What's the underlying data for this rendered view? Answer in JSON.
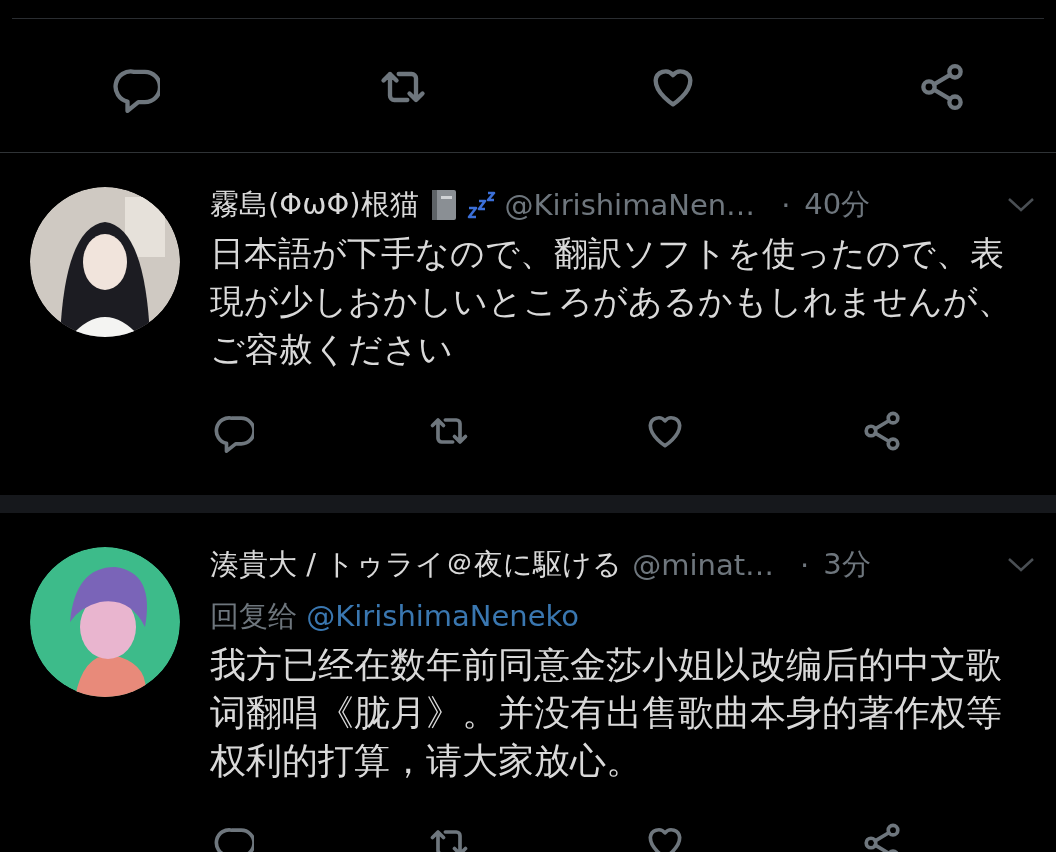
{
  "tweets": [
    {
      "name": "霧島(ΦωΦ)根猫",
      "badges": [
        {
          "kind": "book"
        },
        {
          "kind": "sleep"
        }
      ],
      "handle": "@KirishimaNen…",
      "separator": "·",
      "time": "40分",
      "text": "日本語が下手なので、翻訳ソフトを使ったので、表現が少しおかしいところがあるかもしれませんが、ご容赦ください"
    },
    {
      "name": "湊貴大 / トゥライ＠夜に駆ける",
      "handle": "@minat…",
      "separator": "·",
      "time": "3分",
      "reply_label": "回复给",
      "reply_to": "@KirishimaNeneko",
      "text": "我方已经在数年前同意金莎小姐以改编后的中文歌词翻唱《胧月》。并没有出售歌曲本身的著作权等权利的打算，请大家放心。"
    }
  ]
}
